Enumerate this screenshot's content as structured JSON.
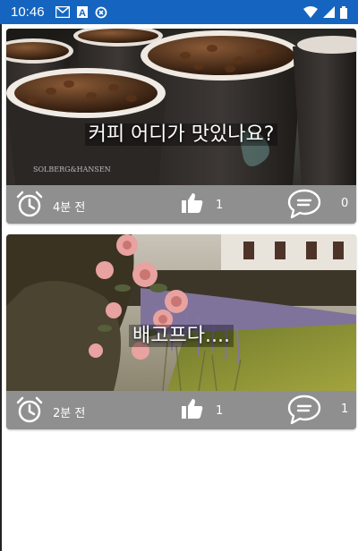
{
  "status_bar": {
    "time": "10:46",
    "left_icons": [
      "gmail-icon",
      "font-icon",
      "sync-icon"
    ],
    "right_icons": [
      "wifi-icon",
      "signal-icon",
      "battery-icon"
    ],
    "color": "#1565c0"
  },
  "posts": [
    {
      "title": "커피 어디가 맛있나요?",
      "time_ago": "4분 전",
      "likes": "1",
      "comments": "0",
      "image": "coffee-cups-image"
    },
    {
      "title": "배고프다....",
      "time_ago": "2분 전",
      "likes": "1",
      "comments": "1",
      "image": "roses-garden-image"
    }
  ]
}
